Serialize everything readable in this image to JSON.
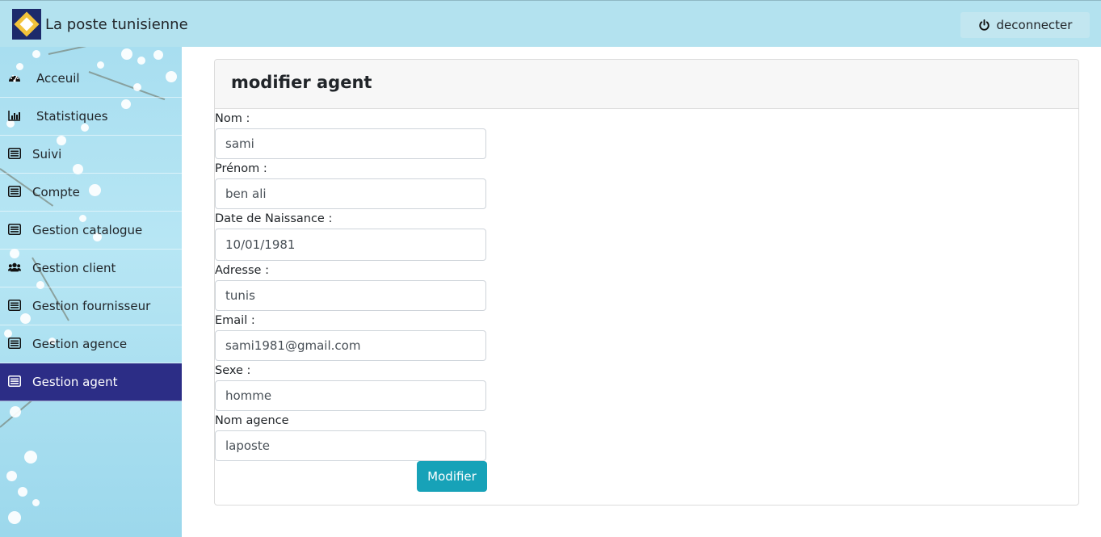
{
  "header": {
    "brand": "La poste tunisienne",
    "logout_label": "deconnecter"
  },
  "sidebar": {
    "items": [
      {
        "label": "Acceuil",
        "icon": "dashboard-icon"
      },
      {
        "label": "Statistiques",
        "icon": "bar-chart-icon"
      },
      {
        "label": "Suivi",
        "icon": "list-icon"
      },
      {
        "label": "Compte",
        "icon": "list-icon"
      },
      {
        "label": "Gestion catalogue",
        "icon": "list-icon"
      },
      {
        "label": "Gestion client",
        "icon": "users-icon"
      },
      {
        "label": "Gestion fournisseur",
        "icon": "list-icon"
      },
      {
        "label": "Gestion agence",
        "icon": "list-icon"
      },
      {
        "label": "Gestion agent",
        "icon": "list-icon",
        "active": true
      }
    ]
  },
  "form": {
    "title": "modifier agent",
    "fields": [
      {
        "label": "Nom :",
        "value": "sami"
      },
      {
        "label": "Prénom :",
        "value": "ben ali"
      },
      {
        "label": "Date de Naissance :",
        "value": "10/01/1981"
      },
      {
        "label": "Adresse :",
        "value": "tunis"
      },
      {
        "label": "Email :",
        "value": "sami1981@gmail.com"
      },
      {
        "label": "Sexe :",
        "value": "homme"
      },
      {
        "label": "Nom agence",
        "value": "laposte"
      }
    ],
    "submit_label": "Modifier"
  },
  "colors": {
    "topbar": "#b3e2ef",
    "sidebar_active": "#2c2d86",
    "submit_button": "#17a2b8"
  }
}
